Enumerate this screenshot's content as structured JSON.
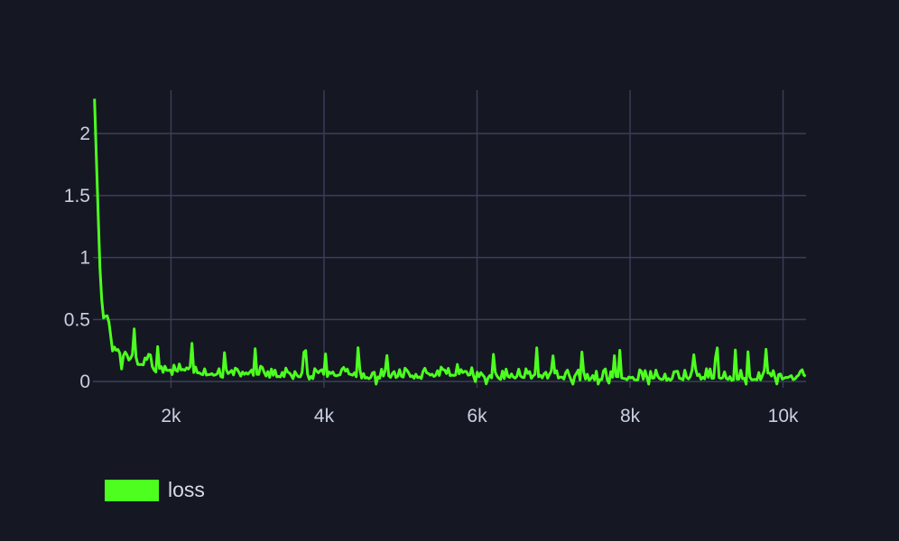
{
  "chart_data": {
    "type": "line",
    "title": "",
    "xlabel": "",
    "ylabel": "",
    "xlim": [
      980,
      10300
    ],
    "ylim": [
      -0.05,
      2.35
    ],
    "x_ticks": [
      2000,
      4000,
      6000,
      8000,
      10000
    ],
    "x_tick_labels": [
      "2k",
      "4k",
      "6k",
      "8k",
      "10k"
    ],
    "y_ticks": [
      0,
      0.5,
      1,
      1.5,
      2
    ],
    "y_tick_labels": [
      "0",
      "0.5",
      "1",
      "1.5",
      "2"
    ],
    "grid": true,
    "legend_position": "bottom-left",
    "colors": {
      "background": "#151823",
      "grid": "#3a3f59",
      "line": "#4dff1f",
      "tick_text": "#c9cfe0"
    },
    "series": [
      {
        "name": "loss",
        "color": "#4dff1f",
        "x": [
          1000,
          1040,
          1080,
          1120,
          1160,
          1200,
          1250,
          1300,
          1350,
          1400,
          1450,
          1500,
          1600,
          1700,
          1800,
          1900,
          2000,
          2200,
          2400,
          2500,
          2700,
          3000,
          3400,
          3800,
          4200,
          4600,
          5000,
          5400,
          5800,
          6200,
          6600,
          7000,
          7400,
          7800,
          8200,
          8600,
          9000,
          9400,
          9800,
          10300
        ],
        "values": [
          2.28,
          1.5,
          0.75,
          0.5,
          0.55,
          0.4,
          0.3,
          0.22,
          0.18,
          0.25,
          0.14,
          0.2,
          0.12,
          0.2,
          0.09,
          0.14,
          0.07,
          0.1,
          0.06,
          0.08,
          0.05,
          0.07,
          0.05,
          0.04,
          0.06,
          0.04,
          0.05,
          0.04,
          0.08,
          0.03,
          0.05,
          0.04,
          0.03,
          0.04,
          0.03,
          0.03,
          0.04,
          0.03,
          0.03,
          0.04
        ]
      }
    ]
  }
}
